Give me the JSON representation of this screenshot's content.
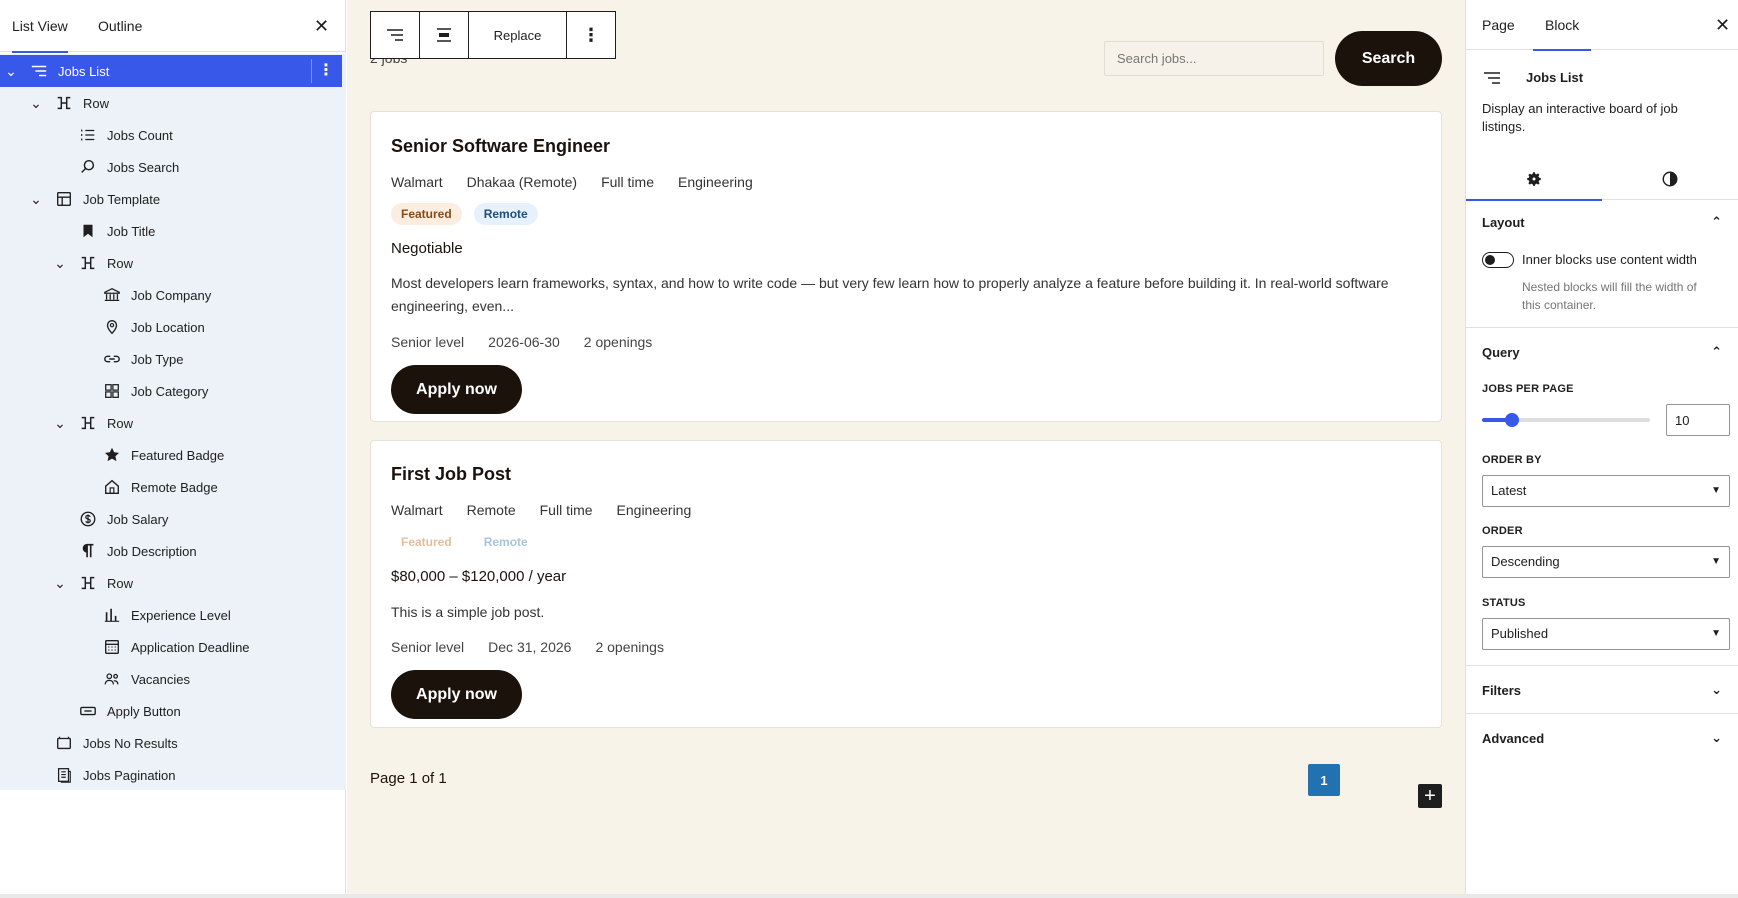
{
  "left_panel": {
    "tabs": [
      {
        "label": "List View"
      },
      {
        "label": "Outline"
      }
    ],
    "tree": [
      {
        "label": "Jobs List",
        "icon": "list-icon",
        "level": 0,
        "expand": "v",
        "selected": true
      },
      {
        "label": "Row",
        "icon": "row-icon",
        "level": 1,
        "expand": "v"
      },
      {
        "label": "Jobs Count",
        "icon": "list-count-icon",
        "level": 2,
        "expand": ""
      },
      {
        "label": "Jobs Search",
        "icon": "search-icon",
        "level": 2,
        "expand": ""
      },
      {
        "label": "Job Template",
        "icon": "layout-icon",
        "level": 1,
        "expand": "v"
      },
      {
        "label": "Job Title",
        "icon": "bookmark-icon",
        "level": 2,
        "expand": ""
      },
      {
        "label": "Row",
        "icon": "row-icon",
        "level": 2,
        "expand": "v"
      },
      {
        "label": "Job Company",
        "icon": "bank-icon",
        "level": 3,
        "expand": ""
      },
      {
        "label": "Job Location",
        "icon": "location-icon",
        "level": 3,
        "expand": ""
      },
      {
        "label": "Job Type",
        "icon": "link-icon",
        "level": 3,
        "expand": ""
      },
      {
        "label": "Job Category",
        "icon": "grid-icon",
        "level": 3,
        "expand": ""
      },
      {
        "label": "Row",
        "icon": "row-icon",
        "level": 2,
        "expand": "v"
      },
      {
        "label": "Featured Badge",
        "icon": "star-icon",
        "level": 3,
        "expand": ""
      },
      {
        "label": "Remote Badge",
        "icon": "home-icon",
        "level": 3,
        "expand": ""
      },
      {
        "label": "Job Salary",
        "icon": "dollar-icon",
        "level": 2,
        "expand": ""
      },
      {
        "label": "Job Description",
        "icon": "paragraph-icon",
        "level": 2,
        "expand": ""
      },
      {
        "label": "Row",
        "icon": "row-icon",
        "level": 2,
        "expand": "v"
      },
      {
        "label": "Experience Level",
        "icon": "bars-icon",
        "level": 3,
        "expand": ""
      },
      {
        "label": "Application Deadline",
        "icon": "calendar-icon",
        "level": 3,
        "expand": ""
      },
      {
        "label": "Vacancies",
        "icon": "people-icon",
        "level": 3,
        "expand": ""
      },
      {
        "label": "Apply Button",
        "icon": "button-icon",
        "level": 2,
        "expand": ""
      },
      {
        "label": "Jobs No Results",
        "icon": "folder-icon",
        "level": 1,
        "expand": ""
      },
      {
        "label": "Jobs Pagination",
        "icon": "page-icon",
        "level": 1,
        "expand": ""
      }
    ]
  },
  "canvas": {
    "toolbar": {
      "replace_label": "Replace"
    },
    "jobs_count": "2 jobs",
    "search": {
      "placeholder": "Search jobs...",
      "button_label": "Search"
    },
    "jobs": [
      {
        "title": "Senior Software Engineer",
        "meta": [
          "Walmart",
          "Dhakaa (Remote)",
          "Full time",
          "Engineering"
        ],
        "badges": [
          "Featured",
          "Remote"
        ],
        "badges_faded": false,
        "salary": "Negotiable",
        "description": "Most developers learn frameworks, syntax, and how to write code — but very few learn how to properly analyze a feature before building it. In real-world software engineering, even...",
        "footer": [
          "Senior level",
          "2026-06-30",
          "2 openings"
        ],
        "apply_label": "Apply now"
      },
      {
        "title": "First Job Post",
        "meta": [
          "Walmart",
          "Remote",
          "Full time",
          "Engineering"
        ],
        "badges": [
          "Featured",
          "Remote"
        ],
        "badges_faded": true,
        "salary": "$80,000 – $120,000 / year",
        "description": "This is a simple job post.",
        "footer": [
          "Senior level",
          "Dec 31, 2026",
          "2 openings"
        ],
        "apply_label": "Apply now"
      }
    ],
    "pagination": {
      "info": "Page 1 of 1",
      "current": "1"
    }
  },
  "right_panel": {
    "tabs": [
      {
        "label": "Page"
      },
      {
        "label": "Block"
      }
    ],
    "block": {
      "name": "Jobs List",
      "description": "Display an interactive board of job listings."
    },
    "layout": {
      "title": "Layout",
      "toggle_label": "Inner blocks use content width",
      "help": "Nested blocks will fill the width of this container.",
      "toggle_on": false
    },
    "query": {
      "title": "Query",
      "jobs_per_page_label": "JOBS PER PAGE",
      "jobs_per_page": "10",
      "slider_fraction": 0.18,
      "order_by_label": "ORDER BY",
      "order_by": "Latest",
      "order_label": "ORDER",
      "order": "Descending",
      "status_label": "STATUS",
      "status": "Published"
    },
    "filters_title": "Filters",
    "advanced_title": "Advanced"
  },
  "colors": {
    "accent": "#3858e9",
    "dark_button": "#1c120c",
    "canvas_bg": "#f8f3e8",
    "page_current": "#2271b1"
  }
}
